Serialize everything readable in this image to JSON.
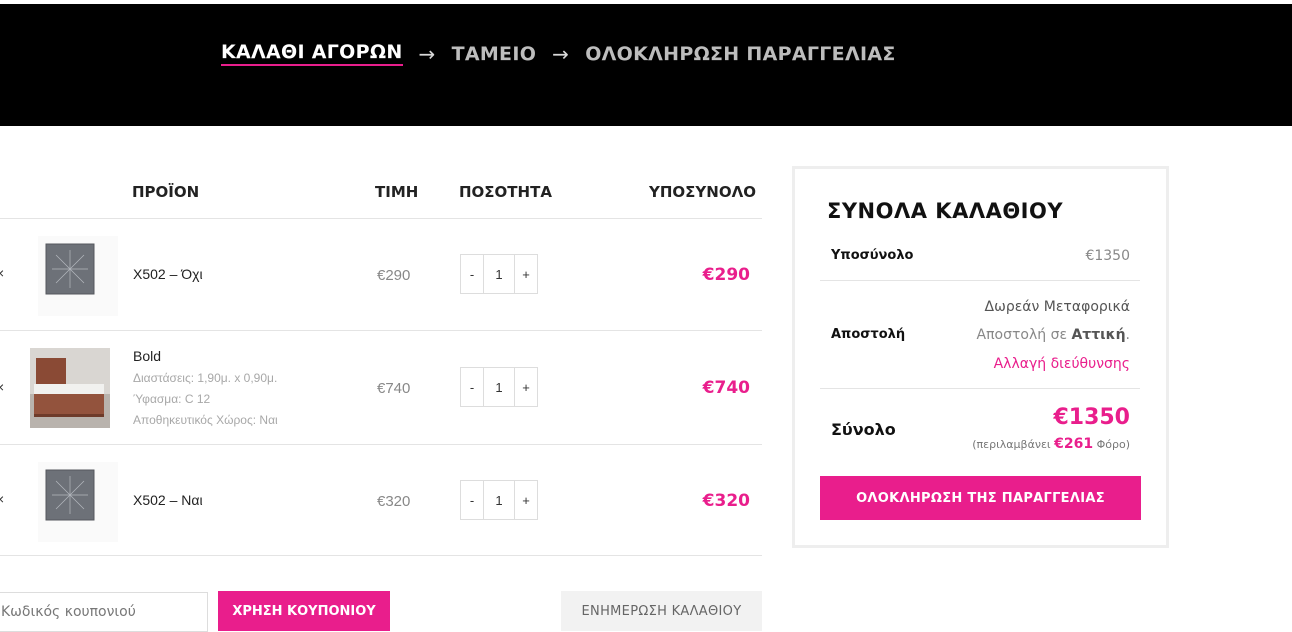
{
  "breadcrumb": {
    "steps": [
      "ΚΑΛΑΘΙ ΑΓΟΡΩΝ",
      "ΤΑΜΕΙΟ",
      "ΟΛΟΚΛΗΡΩΣΗ ΠΑΡΑΓΓΕΛΙΑΣ"
    ],
    "arrow": "→",
    "active_step": 0
  },
  "cart": {
    "headers": {
      "product": "ΠΡΟΪΟΝ",
      "price": "ΤΙΜΗ",
      "quantity": "ΠΟΣΟΤΗΤΑ",
      "subtotal": "ΥΠΟΣΥΝΟΛΟ"
    },
    "remove_glyph": "×",
    "items": [
      {
        "name": "X502 – Όχι",
        "meta": [],
        "price": "€290",
        "qty": "1",
        "subtotal": "€290",
        "thumb": "panel-icon"
      },
      {
        "name": "Bold",
        "meta": [
          "Διαστάσεις: 1,90μ. x 0,90μ.",
          "Ύφασμα: C 12",
          "Αποθηκευτικός Χώρος: Ναι"
        ],
        "price": "€740",
        "qty": "1",
        "subtotal": "€740",
        "thumb": "bed-icon"
      },
      {
        "name": "X502 – Ναι",
        "meta": [],
        "price": "€320",
        "qty": "1",
        "subtotal": "€320",
        "thumb": "panel-icon"
      }
    ],
    "qty_minus": "-",
    "qty_plus": "+",
    "coupon_placeholder": "Κωδικός κουπονιού",
    "coupon_button": "ΧΡΗΣΗ ΚΟΥΠΟΝΙΟΥ",
    "update_button": "ΕΝΗΜΕΡΩΣΗ ΚΑΛΑΘΙΟΥ"
  },
  "totals": {
    "title": "ΣΥΝΟΛΑ ΚΑΛΑΘΙΟΥ",
    "subtotal_label": "Υποσύνολο",
    "subtotal_value": "€1350",
    "shipping_label": "Αποστολή",
    "shipping_method": "Δωρεάν Μεταφορικά",
    "shipping_to_prefix": "Αποστολή σε ",
    "shipping_region": "Αττική",
    "shipping_to_suffix": ".",
    "change_address": "Αλλαγή διεύθυνσης",
    "total_label": "Σύνολο",
    "total_value": "€1350",
    "tax_prefix": "(περιλαμβάνει ",
    "tax_value": "€261",
    "tax_suffix": " Φόρο)",
    "checkout_button": "ΟΛΟΚΛΗΡΩΣΗ ΤΗΣ ΠΑΡΑΓΓΕΛΙΑΣ"
  },
  "colors": {
    "accent": "#e91e8c",
    "header_bg": "#000000",
    "muted": "#888888"
  }
}
